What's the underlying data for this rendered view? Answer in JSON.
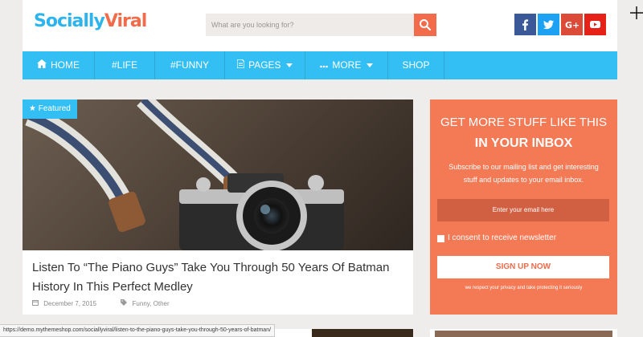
{
  "header": {
    "logo_part1": "Socially",
    "logo_part2": "Viral",
    "search_placeholder": "What are you looking for?",
    "social": [
      {
        "icon": "facebook-icon",
        "color": "#3b5998"
      },
      {
        "icon": "twitter-icon",
        "color": "#1da1f2"
      },
      {
        "icon": "googleplus-icon",
        "color": "#dc4a38"
      },
      {
        "icon": "youtube-icon",
        "color": "#e62117"
      }
    ]
  },
  "nav": {
    "items": [
      {
        "label": "HOME",
        "icon": "home-icon"
      },
      {
        "label": "#LIFE"
      },
      {
        "label": "#FUNNY"
      },
      {
        "label": "PAGES",
        "icon": "page-icon",
        "dropdown": true
      },
      {
        "label": "MORE",
        "icon": "dots-icon",
        "dropdown": true
      },
      {
        "label": "SHOP"
      }
    ]
  },
  "post": {
    "badge": "Featured",
    "title": "Listen To “The Piano Guys” Take You Through 50 Years Of Batman History In This Perfect Medley",
    "date": "December 7, 2015",
    "categories": "Funny, Other"
  },
  "newsletter": {
    "heading": "GET MORE STUFF LIKE THIS",
    "subheading": "IN YOUR INBOX",
    "description_line1": "Subscribe to our mailing list and get interesting",
    "description_line2": "stuff and updates to your email inbox.",
    "email_placeholder": "Enter your email here",
    "consent_label": "I consent to receive newsletter",
    "button_label": "SIGN UP NOW",
    "privacy_note": "we respect your privacy and take protecting it seriously"
  },
  "statusbar": {
    "url": "https://demo.mythemeshop.com/sociallyviral/listen-to-the-piano-guys-take-you-through-50-years-of-batman/"
  },
  "colors": {
    "accent_blue": "#33bff4",
    "accent_orange": "#f26b4a",
    "widget_bg": "#f47a56",
    "page_bg": "#efedec"
  }
}
